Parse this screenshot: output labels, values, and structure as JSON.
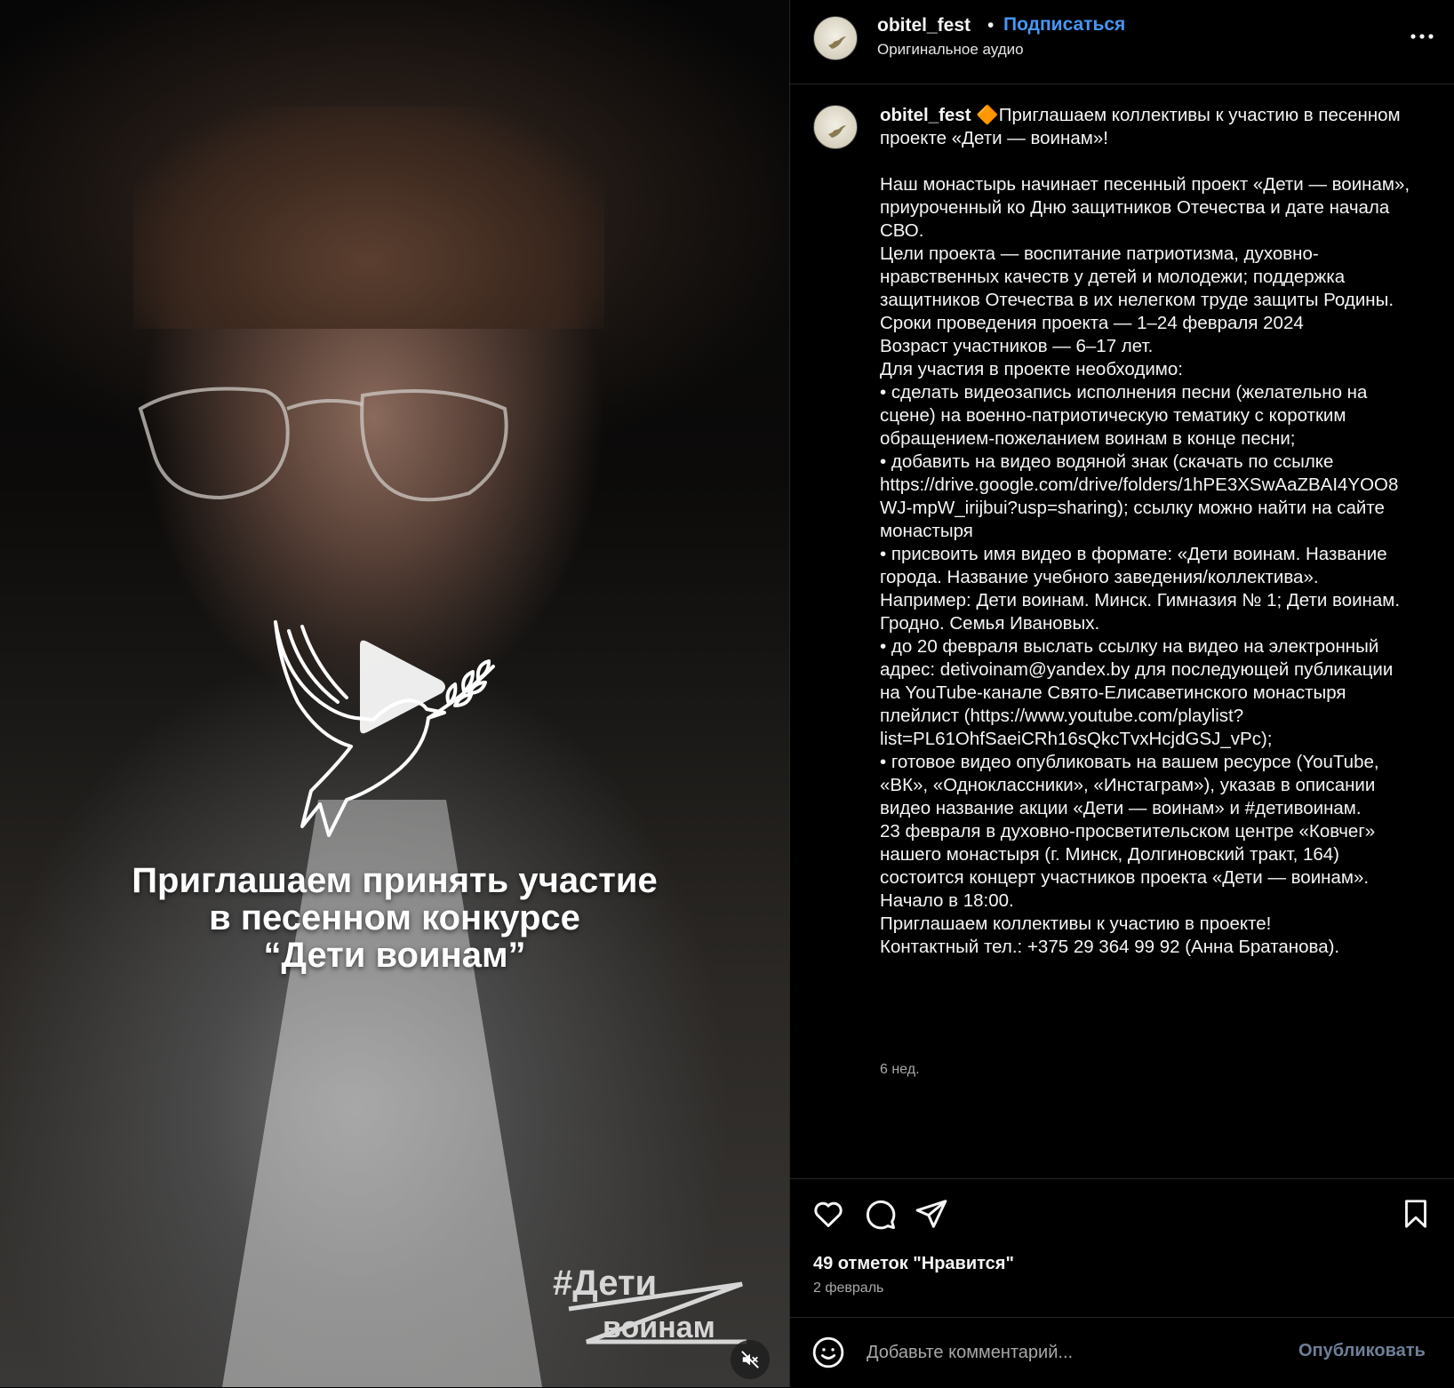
{
  "video": {
    "caption_lines": [
      "Приглашаем принять участие",
      "в песенном конкурсе",
      "“Дети воинам”"
    ],
    "hashtag_line1": "#Дети",
    "hashtag_line2": "воинам",
    "play_icon": "play-icon",
    "mute_icon": "muted-speaker-icon"
  },
  "header": {
    "username": "obitel_fest",
    "separator": "•",
    "follow_label": "Подписаться",
    "audio_label": "Оригинальное аудио",
    "more_icon": "more-horizontal-icon"
  },
  "caption": {
    "username": "obitel_fest",
    "emoji": "🔶",
    "text": "Приглашаем коллективы к участию в песенном проекте «Дети — воинам»!\n\nНаш монастырь начинает песенный проект «Дети — воинам», приуроченный ко Дню защитников Отечества и дате начала СВО.\nЦели проекта — воспитание патриотизма, духовно-нравственных качеств у детей и молодежи; поддержка защитников Отечества в их нелегком труде защиты Родины.\nСроки проведения проекта — 1–24 февраля 2024\nВозраст участников — 6–17 лет.\nДля участия в проекте необходимо:\n• сделать видеозапись исполнения песни (желательно на сцене) на военно-патриотическую тематику с коротким обращением-пожеланием воинам в конце песни;\n• добавить на видео водяной знак (скачать по ссылке https://drive.google.com/drive/folders/1hPE3XSwAaZBAI4YOO8WJ-mpW_irijbui?usp=sharing); ссылку можно найти на сайте монастыря\n• присвоить имя видео в формате: «Дети воинам. Название города. Название учебного заведения/коллектива». Например: Дети воинам. Минск. Гимназия № 1; Дети воинам. Гродно. Семья Ивановых.\n• до 20 февраля выслать ссылку на видео на электронный адрес: detivoinam@yandex.by для последующей публикации на YouTube-канале Свято-Елисаветинского монастыря плейлист (https://www.youtube.com/playlist?list=PL61OhfSaeiCRh16sQkcTvxHcjdGSJ_vPc);\n• готовое видео опубликовать на вашем ресурсе (YouTube, «ВК», «Одноклассники», «Инстаграм»), указав в описании видео название акции «Дети — воинам» и #детивоинам.\n23 февраля в духовно-просветительском центре «Ковчег» нашего монастыря (г. Минск, Долгиновский тракт, 164) состоится концерт участников проекта «Дети — воинам». Начало в 18:00.\nПриглашаем коллективы к участию в проекте!\nКонтактный тел.: +375 29 364 99 92 (Анна Братанова).",
    "time_ago": "6 нед."
  },
  "actions": {
    "like_icon": "heart-icon",
    "comment_icon": "comment-icon",
    "share_icon": "paper-plane-icon",
    "save_icon": "bookmark-icon",
    "likes_text": "49 отметок \"Нравится\"",
    "post_date": "2 февраль"
  },
  "comment": {
    "emoji_icon": "smiley-icon",
    "placeholder": "Добавьте комментарий...",
    "publish_label": "Опубликовать"
  },
  "colors": {
    "background": "#000000",
    "link_blue": "#4796f5",
    "publish_disabled": "#6e7f98",
    "secondary_text": "#a8a8a8",
    "divider": "#262626"
  }
}
